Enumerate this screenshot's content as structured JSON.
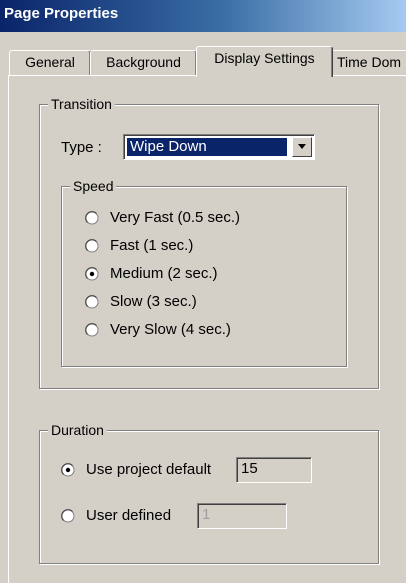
{
  "window": {
    "title": "Page Properties"
  },
  "tabs": [
    {
      "label": "General"
    },
    {
      "label": "Background"
    },
    {
      "label": "Display Settings"
    },
    {
      "label": "Time Dom"
    }
  ],
  "active_tab": "Display Settings",
  "transition": {
    "legend": "Transition",
    "type_label": "Type :",
    "type_value": "Wipe Down",
    "speed": {
      "legend": "Speed",
      "options": [
        {
          "label": "Very Fast (0.5 sec.)",
          "selected": false
        },
        {
          "label": "Fast (1 sec.)",
          "selected": false
        },
        {
          "label": "Medium (2 sec.)",
          "selected": true
        },
        {
          "label": "Slow (3 sec.)",
          "selected": false
        },
        {
          "label": "Very Slow (4 sec.)",
          "selected": false
        }
      ]
    }
  },
  "duration": {
    "legend": "Duration",
    "use_default": {
      "label": "Use project default",
      "selected": true,
      "value": "15"
    },
    "user_defined": {
      "label": "User defined",
      "selected": false,
      "value": "1"
    }
  },
  "colors": {
    "titlebar_start": "#0a246a",
    "titlebar_end": "#a6caf0",
    "face": "#d4d0c8",
    "highlight": "#0a246a"
  },
  "icons": {
    "dropdown": "triangle-down-icon",
    "radio": "radio-button-icon"
  }
}
